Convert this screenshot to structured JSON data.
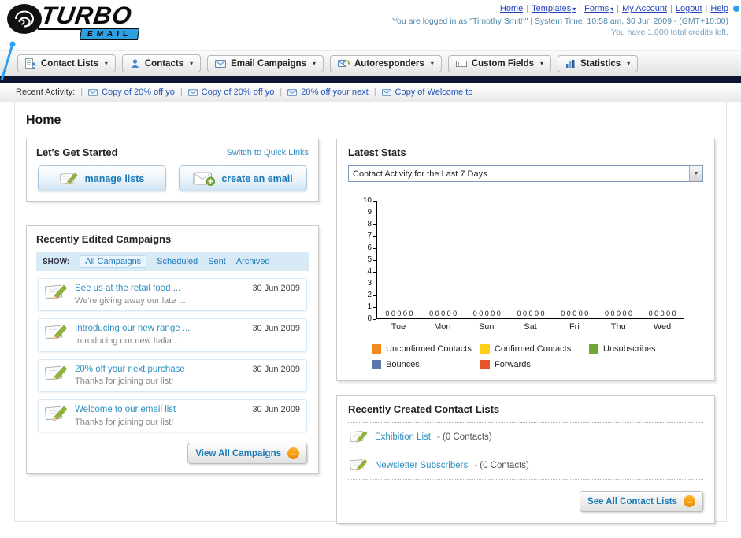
{
  "header": {
    "logo_title": "TURBO",
    "logo_subtitle": "EMAIL",
    "links": [
      {
        "label": "Home"
      },
      {
        "label": "Templates"
      },
      {
        "label": "Forms"
      },
      {
        "label": "My Account"
      },
      {
        "label": "Logout"
      },
      {
        "label": "Help"
      }
    ],
    "login_info": "You are logged in as \"Timothy Smith\" | System Time: 10:58 am, 30 Jun 2009 - (GMT+10:00)",
    "credits_info": "You have 1,000 total credits left."
  },
  "nav": {
    "tabs": [
      {
        "label": "Contact Lists"
      },
      {
        "label": "Contacts"
      },
      {
        "label": "Email Campaigns"
      },
      {
        "label": "Autoresponders"
      },
      {
        "label": "Custom Fields"
      },
      {
        "label": "Statistics"
      }
    ]
  },
  "recent_activity": {
    "label": "Recent Activity:",
    "items": [
      "Copy of 20% off yo",
      "Copy of 20% off yo",
      "20% off your next",
      "Copy of Welcome to"
    ]
  },
  "page": {
    "title": "Home"
  },
  "get_started": {
    "title": "Let's Get Started",
    "switch_link": "Switch to Quick Links",
    "manage_lists_label": "manage lists",
    "create_email_label": "create an email"
  },
  "campaigns": {
    "title": "Recently Edited Campaigns",
    "show_label": "SHOW:",
    "filters": [
      {
        "label": "All Campaigns",
        "selected": true
      },
      {
        "label": "Scheduled",
        "selected": false
      },
      {
        "label": "Sent",
        "selected": false
      },
      {
        "label": "Archived",
        "selected": false
      }
    ],
    "items": [
      {
        "title": "See us at the retail food ...",
        "subtitle": "We're giving away our late ...",
        "date": "30 Jun 2009"
      },
      {
        "title": "Introducing our new range ...",
        "subtitle": "Introducing our new Italia ...",
        "date": "30 Jun 2009"
      },
      {
        "title": "20% off your next purchase",
        "subtitle": "Thanks for joining our list!",
        "date": "30 Jun 2009"
      },
      {
        "title": "Welcome to our email list",
        "subtitle": "Thanks for joining our list!",
        "date": "30 Jun 2009"
      }
    ],
    "view_all_label": "View All Campaigns"
  },
  "stats": {
    "title": "Latest Stats",
    "period_selected": "Contact Activity for the Last 7 Days"
  },
  "chart_data": {
    "type": "bar",
    "title": "Contact Activity for the Last 7 Days",
    "categories": [
      "Tue",
      "Mon",
      "Sun",
      "Sat",
      "Fri",
      "Thu",
      "Wed"
    ],
    "series": [
      {
        "name": "Unconfirmed Contacts",
        "color": "#f28a1f",
        "values": [
          0,
          0,
          0,
          0,
          0,
          0,
          0
        ]
      },
      {
        "name": "Confirmed Contacts",
        "color": "#fdd017",
        "values": [
          0,
          0,
          0,
          0,
          0,
          0,
          0
        ]
      },
      {
        "name": "Unsubscribes",
        "color": "#6fa832",
        "values": [
          0,
          0,
          0,
          0,
          0,
          0,
          0
        ]
      },
      {
        "name": "Bounces",
        "color": "#5878ad",
        "values": [
          0,
          0,
          0,
          0,
          0,
          0,
          0
        ]
      },
      {
        "name": "Forwards",
        "color": "#e8542a",
        "values": [
          0,
          0,
          0,
          0,
          0,
          0,
          0
        ]
      }
    ],
    "ylim": [
      0,
      10
    ],
    "yticks": [
      0,
      1,
      2,
      3,
      4,
      5,
      6,
      7,
      8,
      9,
      10
    ],
    "grid": false,
    "legend_position": "bottom"
  },
  "contact_lists": {
    "title": "Recently Created Contact Lists",
    "items": [
      {
        "name": "Exhibition List",
        "meta": "- (0 Contacts)"
      },
      {
        "name": "Newsletter Subscribers",
        "meta": "- (0 Contacts)"
      }
    ],
    "see_all_label": "See All Contact Lists"
  },
  "icons": {
    "caret_down": "▾",
    "select_caret": "▼",
    "arrow_right": "→",
    "separator": "|"
  }
}
